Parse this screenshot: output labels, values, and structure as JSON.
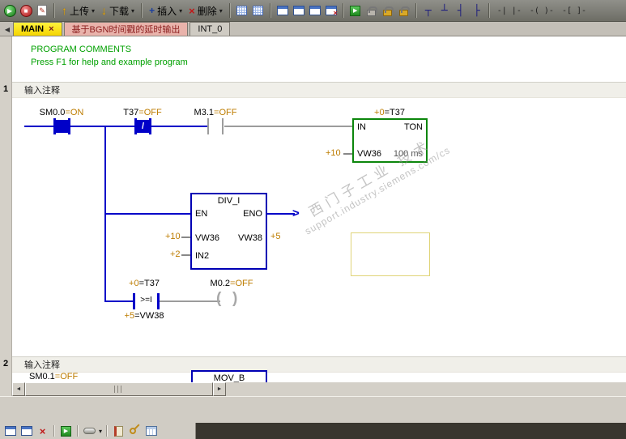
{
  "glyphs": {
    "play": "▶",
    "stop": "■",
    "edit": "✎",
    "up": "↑",
    "down": "↓",
    "caret": "▾",
    "insert_plus": "+",
    "delete_x": "×",
    "win_x": "×",
    "line_down": "┬",
    "line_up": "┴",
    "line_left": "┤",
    "line_right": "├",
    "contact_tool": "-| |-",
    "coil_tool": "-( )-",
    "box_tool": "-[ ]-",
    "tab_back": "◀",
    "scroll_left": "◄",
    "scroll_right": "►",
    "arrowhead": ">",
    "paren_l": "(",
    "paren_r": ")",
    "run_play": "▶"
  },
  "top_toolbar": {
    "upload": "上传",
    "download": "下载",
    "insert": "插入",
    "delete": "删除"
  },
  "tabs": {
    "items": [
      {
        "label": "MAIN",
        "close": "×"
      },
      {
        "label": "基于BGN时间戳的延时输出"
      },
      {
        "label": "INT_0"
      }
    ]
  },
  "comments": {
    "title": "PROGRAM COMMENTS",
    "subtitle": "Press F1 for help and example program"
  },
  "net1": {
    "number": "1",
    "comment": "输入注释",
    "c1_operand": "SM0.0",
    "c1_status": "=ON",
    "c2_operand": "T37",
    "c2_status": "=OFF",
    "c2_slash": "/",
    "c3_operand": "M3.1",
    "c3_status": "=OFF",
    "timer_status": "+0",
    "timer_operand": "=T37",
    "timer_in": "IN",
    "timer_type": "TON",
    "timer_pt_status": "+10",
    "timer_pt_operand": "VW36",
    "timer_base": "100 ms",
    "div_title": "DIV_I",
    "div_en": "EN",
    "div_eno": "ENO",
    "div_in1_status": "+10",
    "div_in1_operand": "VW36",
    "div_out_operand": "VW38",
    "div_out_status": "+5",
    "div_in2_status": "+2",
    "div_in2_label": "IN2",
    "cmp_above_status": "+0",
    "cmp_above_operand": "=T37",
    "cmp_op": ">=I",
    "cmp_below_status": "+5",
    "cmp_below_operand": "=VW38",
    "coil_operand": "M0.2",
    "coil_status": "=OFF"
  },
  "net2": {
    "number": "2",
    "comment": "输入注释",
    "c1_operand": "SM0.1",
    "c1_status": "=OFF",
    "box_title": "MOV_B"
  },
  "watermark": {
    "line1": "西门子工业  技术",
    "line2": "support.industry.siemens.com/cs"
  }
}
